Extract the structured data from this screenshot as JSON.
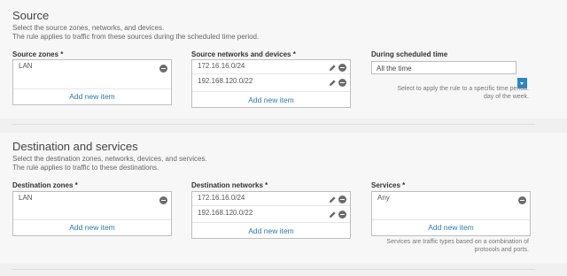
{
  "source": {
    "title": "Source",
    "desc_line1": "Select the source zones, networks, and devices.",
    "desc_line2": "The rule applies to traffic from these sources during the scheduled time period.",
    "zones": {
      "label": "Source zones *",
      "items": [
        "LAN"
      ],
      "add_label": "Add new item"
    },
    "networks": {
      "label": "Source networks and devices *",
      "items": [
        "172.16.16.0/24",
        "192.168.120.0/22"
      ],
      "add_label": "Add new item"
    },
    "schedule": {
      "label": "During scheduled time",
      "value": "All the time",
      "help_line1": "Select to apply the rule to a specific time period.",
      "help_line2": "day of the week."
    }
  },
  "destination": {
    "title": "Destination and services",
    "desc_line1": "Select the destination zones, networks, devices, and services.",
    "desc_line2": "The rule applies to traffic to these destinations.",
    "zones": {
      "label": "Destination zones *",
      "items": [
        "LAN"
      ],
      "add_label": "Add new item"
    },
    "networks": {
      "label": "Destination networks *",
      "items": [
        "172.16.16.0/24",
        "192.168.120.0/22"
      ],
      "add_label": "Add new item"
    },
    "services": {
      "label": "Services *",
      "items": [
        "Any"
      ],
      "add_label": "Add new item",
      "help_line1": "Services are traffic types based on a combination of",
      "help_line2": "protocols and ports."
    }
  },
  "colors": {
    "accent": "#2a86c9",
    "link": "#2a7ab8"
  }
}
